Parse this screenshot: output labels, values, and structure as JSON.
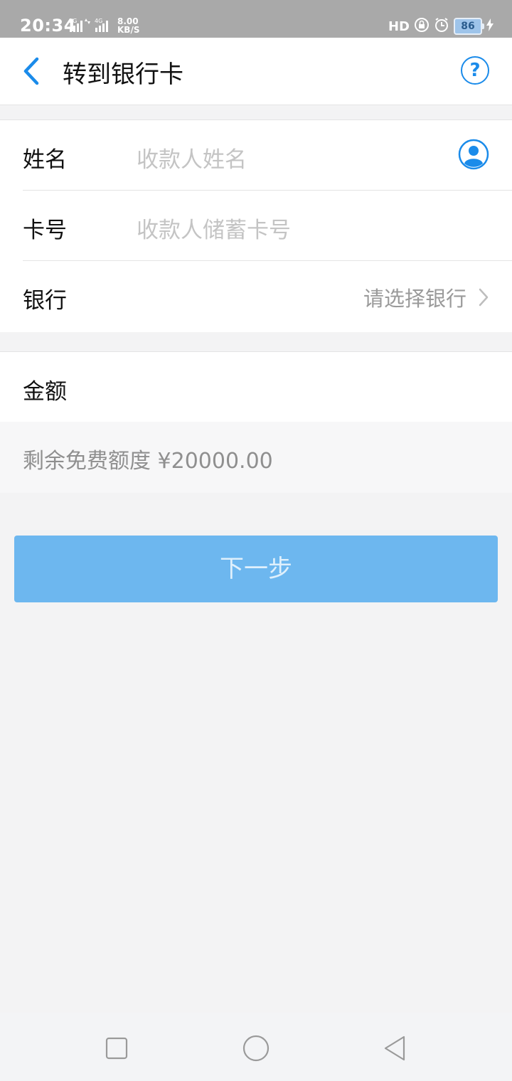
{
  "status_bar": {
    "time": "20:34",
    "network_2g": "2G",
    "network_4g": "4G",
    "speed_value": "8.00",
    "speed_unit": "KB/S",
    "hd_label": "HD",
    "battery": "86"
  },
  "header": {
    "title": "转到银行卡",
    "back_icon": "chevron-left-icon",
    "help_icon": "question-circle-icon",
    "help_glyph": "?"
  },
  "form": {
    "name_label": "姓名",
    "name_placeholder": "收款人姓名",
    "card_label": "卡号",
    "card_placeholder": "收款人储蓄卡号",
    "bank_label": "银行",
    "bank_hint": "请选择银行",
    "amount_label": "金额"
  },
  "quota_text": "剩余免费额度 ¥20000.00",
  "next_button": "下一步",
  "colors": {
    "accent": "#1a8bea",
    "button_disabled": "#6db7ef",
    "background": "#f3f3f4"
  }
}
